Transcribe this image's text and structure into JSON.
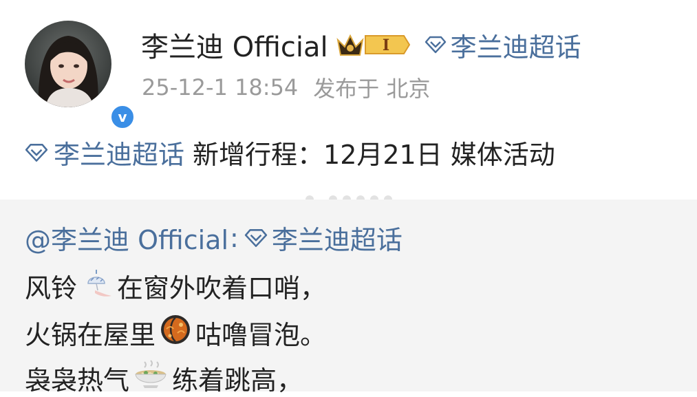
{
  "post": {
    "username": "李兰迪 Official",
    "badge_level": "I",
    "topic_link": "李兰迪超话",
    "timestamp": "25-12-1 18:54",
    "location": "发布于 北京",
    "text_topic": "李兰迪超话",
    "text_body": "新增行程：12月21日 媒体活动"
  },
  "repost": {
    "mention": "@李兰迪 Official",
    "colon": ":",
    "topic": "李兰迪超话",
    "lines": [
      {
        "before": "风铃",
        "emoji": "wind-chime-icon",
        "after": "在窗外吹着口哨，"
      },
      {
        "before": "火锅在屋里",
        "emoji": "hotpot-icon",
        "after": "咕噜冒泡。"
      },
      {
        "before": "袅袅热气",
        "emoji": "noodle-bowl-icon",
        "after": "练着跳高，"
      }
    ]
  },
  "colors": {
    "link": "#4a6f9c",
    "verified": "#3a8ee6",
    "repost_bg": "#f4f4f4",
    "meta": "#9a9a9a"
  }
}
